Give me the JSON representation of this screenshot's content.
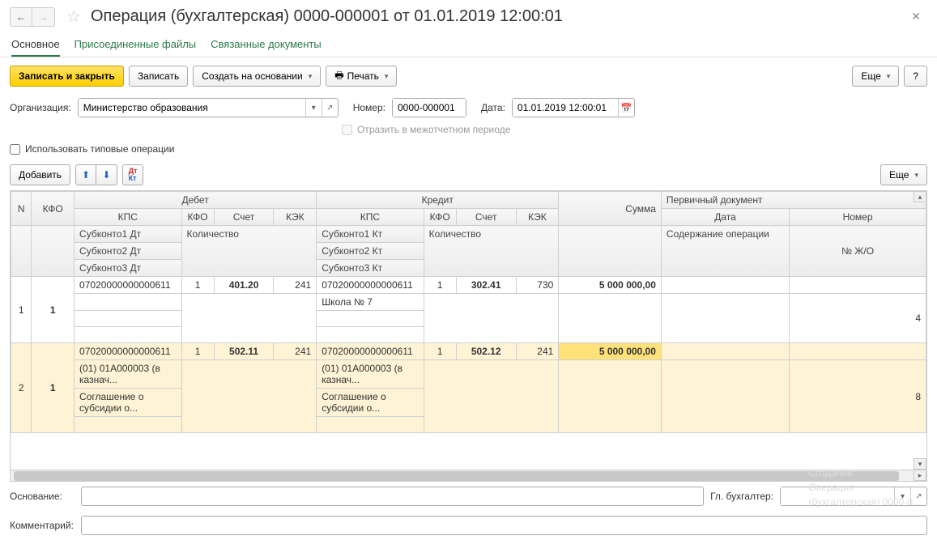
{
  "header": {
    "title": "Операция (бухгалтерская) 0000-000001 от 01.01.2019 12:00:01"
  },
  "tabs": {
    "main": "Основное",
    "files": "Присоединенные файлы",
    "linked": "Связанные документы"
  },
  "toolbar": {
    "save_close": "Записать и закрыть",
    "save": "Записать",
    "create_on": "Создать на основании",
    "print": "Печать",
    "more": "Еще",
    "help": "?"
  },
  "form": {
    "org_label": "Организация:",
    "org_value": "Министерство образования",
    "number_label": "Номер:",
    "number_value": "0000-000001",
    "date_label": "Дата:",
    "date_value": "01.01.2019 12:00:01",
    "interperiod": "Отразить в межотчетном периоде",
    "use_typical": "Использовать типовые операции"
  },
  "gridbar": {
    "add": "Добавить",
    "more": "Еще"
  },
  "grid_headers": {
    "n": "N",
    "kfo": "КФО",
    "debit": "Дебет",
    "credit": "Кредит",
    "sum": "Сумма",
    "primary_doc": "Первичный документ",
    "kps": "КПС",
    "account": "Счет",
    "kek": "КЭК",
    "sub1d": "Субконто1 Дт",
    "sub2d": "Субконто2 Дт",
    "sub3d": "Субконто3 Дт",
    "sub1k": "Субконто1 Кт",
    "sub2k": "Субконто2 Кт",
    "sub3k": "Субконто3 Кт",
    "qty": "Количество",
    "date": "Дата",
    "number": "Номер",
    "op_content": "Содержание операции",
    "jo": "№ Ж/О"
  },
  "rows": [
    {
      "n": "1",
      "kfo": "1",
      "d_kps": "07020000000000611",
      "d_kfo": "1",
      "d_acc": "401.20",
      "d_kek": "241",
      "k_kps": "07020000000000611",
      "k_kfo": "1",
      "k_acc": "302.41",
      "k_kek": "730",
      "sum": "5 000 000,00",
      "k_sub1": "Школа № 7",
      "jo": "4"
    },
    {
      "n": "2",
      "kfo": "1",
      "d_kps": "07020000000000611",
      "d_kfo": "1",
      "d_acc": "502.11",
      "d_kek": "241",
      "k_kps": "07020000000000611",
      "k_kfo": "1",
      "k_acc": "502.12",
      "k_kek": "241",
      "sum": "5 000 000,00",
      "d_sub1": "(01) 01А000003 (в казнач...",
      "d_sub2": "Соглашение о субсидии о...",
      "k_sub1": "(01) 01А000003 (в казнач...",
      "k_sub2": "Соглашение о субсидии о...",
      "jo": "8"
    }
  ],
  "footer": {
    "basis_label": "Основание:",
    "chief_acc_label": "Гл. бухгалтер:",
    "comment_label": "Комментарий:"
  },
  "ghost": {
    "l1": "Создание:",
    "l2": "Операция",
    "l3": "(бухгалтерская) 0000-0..."
  }
}
